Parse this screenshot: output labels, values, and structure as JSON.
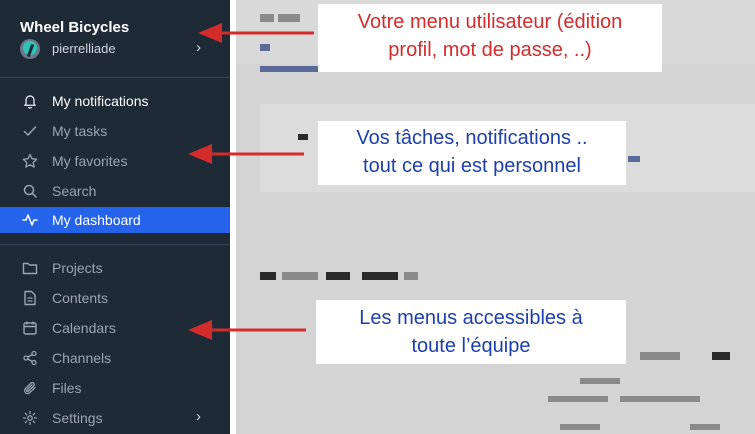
{
  "sidebar": {
    "workspace": "Wheel Bicycles",
    "user": {
      "name": "pierrelliade"
    },
    "personal": [
      {
        "label": "My notifications",
        "icon": "bell-icon"
      },
      {
        "label": "My tasks",
        "icon": "check-icon"
      },
      {
        "label": "My favorites",
        "icon": "star-icon"
      },
      {
        "label": "Search",
        "icon": "search-icon"
      },
      {
        "label": "My dashboard",
        "icon": "activity-icon",
        "active": true
      }
    ],
    "team": [
      {
        "label": "Projects",
        "icon": "folder-icon"
      },
      {
        "label": "Contents",
        "icon": "document-icon"
      },
      {
        "label": "Calendars",
        "icon": "calendar-icon"
      },
      {
        "label": "Channels",
        "icon": "share-icon"
      },
      {
        "label": "Files",
        "icon": "paperclip-icon"
      },
      {
        "label": "Settings",
        "icon": "gear-icon"
      }
    ]
  },
  "callouts": {
    "user_menu": {
      "line1": "Votre menu utilisateur (édition",
      "line2": "profil, mot de passe, ..)"
    },
    "personal": {
      "line1": "Vos tâches, notifications ..",
      "line2": "tout ce qui est personnel"
    },
    "team": {
      "line1": "Les menus accessibles à",
      "line2": "toute l’équipe"
    }
  },
  "colors": {
    "sidebar_bg": "#1f2a37",
    "active_bg": "#2563eb",
    "arrow": "#d42b2b",
    "callout_red": "#d42b2b",
    "callout_blue": "#1c3fae"
  }
}
